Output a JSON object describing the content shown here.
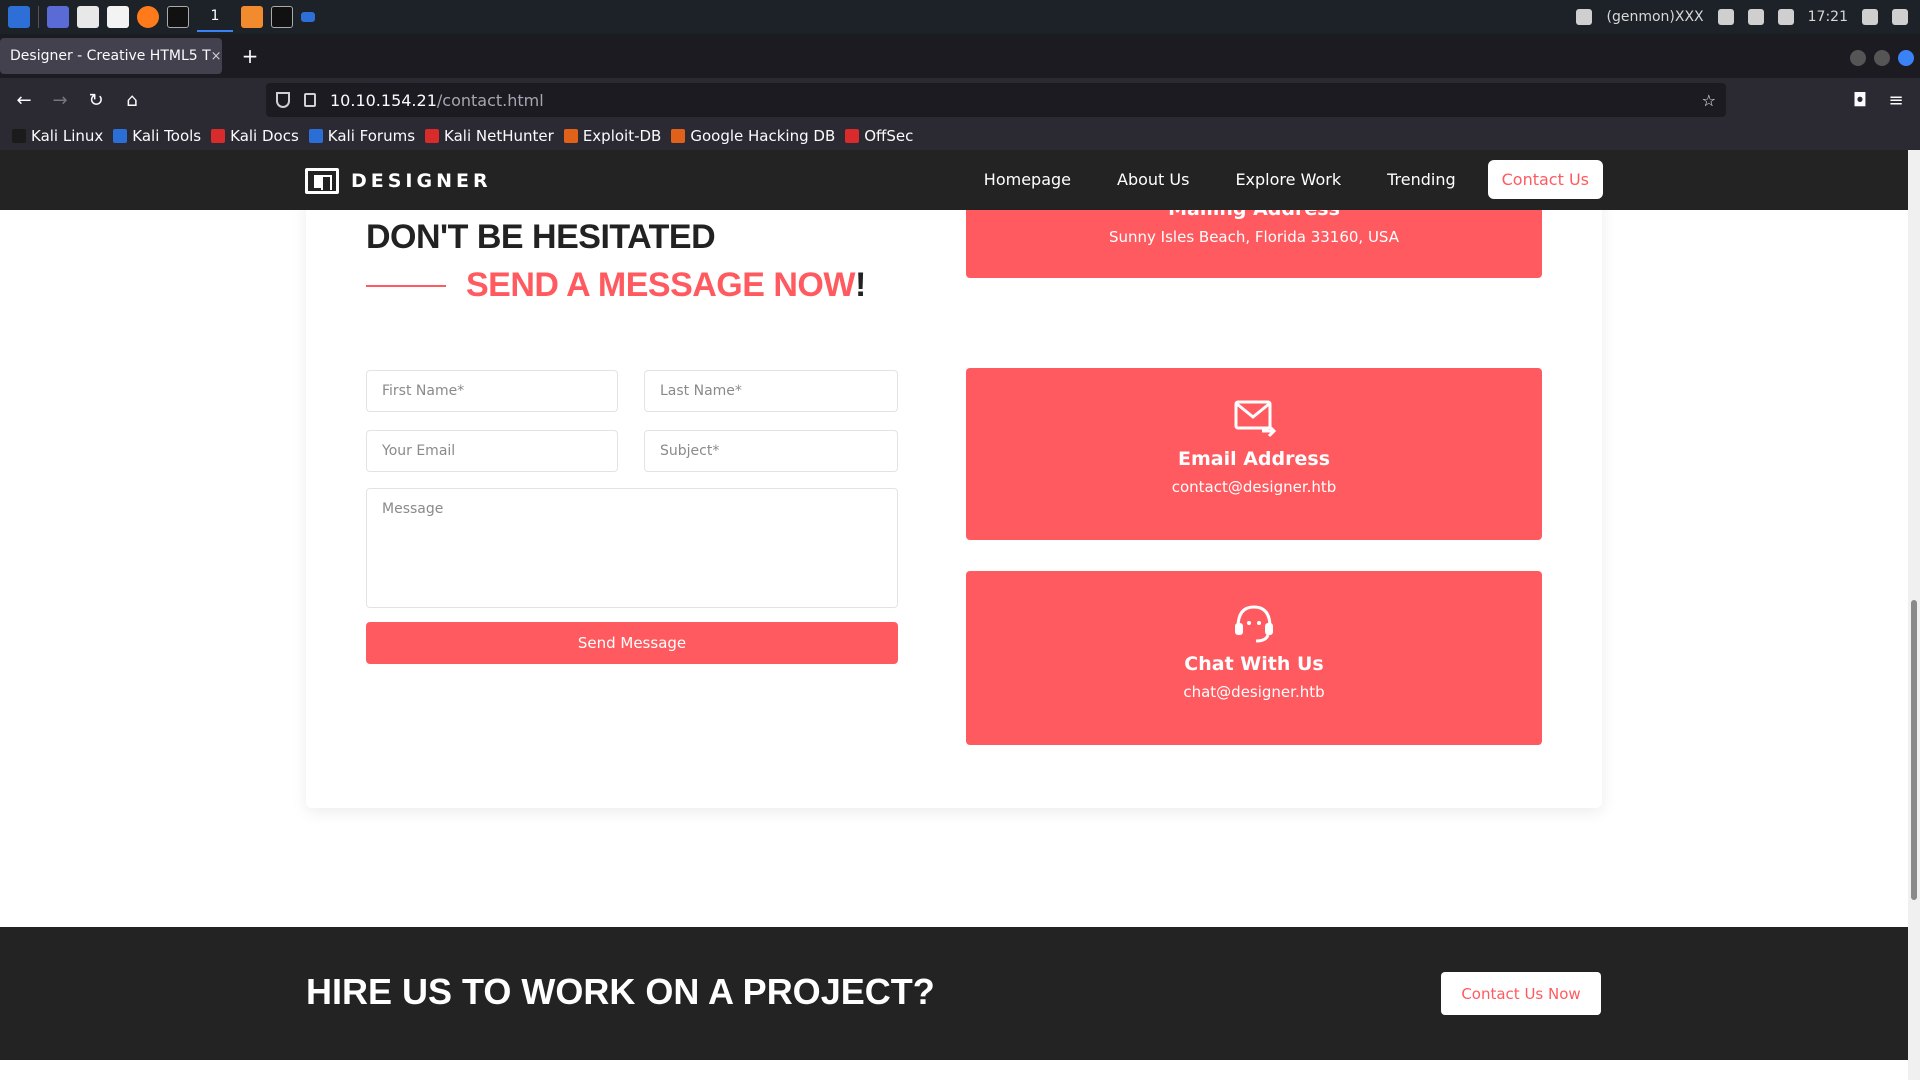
{
  "taskbar": {
    "workspace": "1",
    "user": "(genmon)XXX",
    "time": "17:21"
  },
  "browser": {
    "tab_title": "Designer - Creative HTML5 T",
    "tab_close": "×",
    "new_tab": "+",
    "url_host": "10.10.154.21",
    "url_path": "/contact.html"
  },
  "bookmarks": [
    {
      "label": "Kali Linux",
      "color": "#1b1b1b"
    },
    {
      "label": "Kali Tools",
      "color": "#2b6fd6"
    },
    {
      "label": "Kali Docs",
      "color": "#d92b2b"
    },
    {
      "label": "Kali Forums",
      "color": "#2b6fd6"
    },
    {
      "label": "Kali NetHunter",
      "color": "#d92b2b"
    },
    {
      "label": "Exploit-DB",
      "color": "#e0621a"
    },
    {
      "label": "Google Hacking DB",
      "color": "#e0621a"
    },
    {
      "label": "OffSec",
      "color": "#d92b2b"
    }
  ],
  "site": {
    "logo": "DESIGNER",
    "nav": [
      "Homepage",
      "About Us",
      "Explore Work",
      "Trending",
      "Contact Us"
    ]
  },
  "contact": {
    "heading": "DON'T BE HESITATED",
    "subheading": "SEND A MESSAGE NOW",
    "subheading_punct": "!",
    "fields": {
      "first_name": "First Name*",
      "last_name": "Last Name*",
      "email": "Your Email",
      "subject": "Subject*",
      "message": "Message"
    },
    "send_label": "Send Message"
  },
  "info_cards": [
    {
      "title": "Mailing Address",
      "value": "Sunny Isles Beach, Florida 33160, USA",
      "icon": "location-icon"
    },
    {
      "title": "Email Address",
      "value": "contact@designer.htb",
      "icon": "mail-icon"
    },
    {
      "title": "Chat With Us",
      "value": "chat@designer.htb",
      "icon": "headset-icon"
    }
  ],
  "cta": {
    "title": "HIRE US TO WORK ON A PROJECT?",
    "button": "Contact Us Now"
  },
  "colors": {
    "accent": "#ff5a5f",
    "dark": "#232323"
  }
}
